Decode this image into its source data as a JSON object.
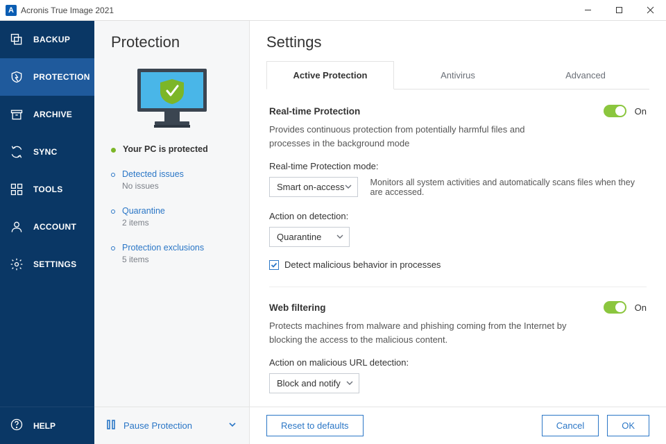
{
  "app": {
    "title": "Acronis True Image 2021",
    "icon_letter": "A"
  },
  "sidebar": {
    "items": [
      {
        "label": "BACKUP"
      },
      {
        "label": "PROTECTION"
      },
      {
        "label": "ARCHIVE"
      },
      {
        "label": "SYNC"
      },
      {
        "label": "TOOLS"
      },
      {
        "label": "ACCOUNT"
      },
      {
        "label": "SETTINGS"
      }
    ],
    "help_label": "HELP"
  },
  "protection_panel": {
    "title": "Protection",
    "status_protected": "Your PC is protected",
    "detected_issues": {
      "title": "Detected issues",
      "sub": "No issues"
    },
    "quarantine": {
      "title": "Quarantine",
      "sub": "2 items"
    },
    "exclusions": {
      "title": "Protection exclusions",
      "sub": "5 items"
    },
    "pause_label": "Pause Protection"
  },
  "settings_panel": {
    "title": "Settings",
    "tabs": [
      {
        "label": "Active Protection"
      },
      {
        "label": "Antivirus"
      },
      {
        "label": "Advanced"
      }
    ],
    "realtime": {
      "title": "Real-time Protection",
      "toggle_label": "On",
      "desc": "Provides continuous protection from potentially harmful files and processes in the background mode",
      "mode_label": "Real-time Protection mode:",
      "mode_value": "Smart on-access",
      "mode_hint": "Monitors all system activities and automatically scans files when they are accessed.",
      "action_label": "Action on detection:",
      "action_value": "Quarantine",
      "checkbox_label": "Detect malicious behavior in processes"
    },
    "web": {
      "title": "Web filtering",
      "toggle_label": "On",
      "desc": "Protects machines from malware and phishing coming from the Internet by blocking the access to the malicious content.",
      "action_label": "Action on malicious URL detection:",
      "action_value": "Block and notify"
    }
  },
  "footer": {
    "reset": "Reset to defaults",
    "cancel": "Cancel",
    "ok": "OK"
  }
}
